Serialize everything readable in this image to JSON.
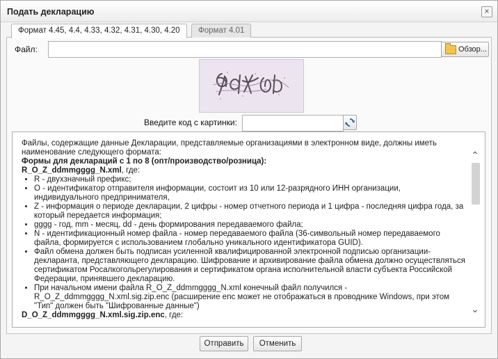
{
  "background_stub": [
    "0",
    "0",
    "0",
    "0",
    "0",
    "0",
    "0",
    "0",
    "0",
    "0"
  ],
  "dialog": {
    "title": "Подать декларацию",
    "close_glyph": "×",
    "close_icon": "close-icon"
  },
  "tabs": [
    {
      "label": "Формат 4.45, 4.4, 4.33, 4.32, 4.31, 4.30, 4.20",
      "active": true
    },
    {
      "label": "Формат 4.01",
      "active": false
    }
  ],
  "file": {
    "label": "Файл:",
    "value": "",
    "browse_label": "Обзор...",
    "browse_icon": "folder-icon"
  },
  "captcha": {
    "code_label": "Введите код с картинки:",
    "code_value": "",
    "refresh_icon": "refresh-icon"
  },
  "info": {
    "intro": "Файлы, содержащие данные Декларации, представляемые организациями в электронном виде, должны иметь наименование следующего формата:",
    "forms_heading": "Формы для деклараций с 1 по 8 (опт/производство/розница):",
    "name_format": "R_O_Z_ddmmgggg_N.xml",
    "where": ", где:",
    "bullets": [
      "R - двухзначный префикс;",
      "O - идентификатор отправителя информации, состоит из 10 или 12-разрядного ИНН организации, индивидуального предпринимателя,",
      "Z - информация о периоде декларации, 2 цифры - номер отчетного периода и 1 цифра - последняя цифра года, за который передается информация;",
      "gggg - год, mm - месяц, dd - день формирования передаваемого файла;",
      "N - идентификационный номер файла - номер передаваемого файла (36-символьный номер передаваемого файла, формируется с использованием глобально уникального идентификатора GUID).",
      "Файл обмена должен быть подписан усиленной квалифицированной электронной подписью организации-декларанта, представляющего декларацию. Шифрование и архивирование файла обмена должно осуществляться сертификатом Росалкогольрегулирования и сертификатом органа исполнительной власти субъекта Российской Федерации, принявшего декларацию.",
      "При начальном имени файла R_O_Z_ddmmgggg_N.xml конечный файл получился - R_O_Z_ddmmgggg_N.xml.sig.zip.enc (расширение enc может не отображаться в проводнике Windows, при этом \"Тип\" должен быть \"Шифрованные данные\")"
    ],
    "final_format": "D_O_Z_ddmmgggg_N.xml.sig.zip.enc",
    "final_where": ", где:",
    "scroll_up_glyph": "⌃",
    "scroll_down_glyph": "⌄"
  },
  "buttons": {
    "send": "Отправить",
    "cancel": "Отменить"
  }
}
